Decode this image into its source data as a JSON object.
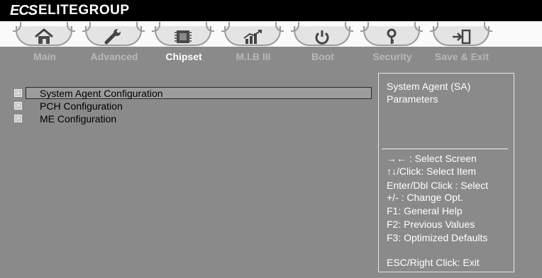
{
  "header": {
    "logo_text": "ECS",
    "brand": "ELITEGROUP"
  },
  "tabs": [
    {
      "label": "Main",
      "icon": "home-icon",
      "active": false
    },
    {
      "label": "Advanced",
      "icon": "wrench-icon",
      "active": false
    },
    {
      "label": "Chipset",
      "icon": "chip-icon",
      "active": true
    },
    {
      "label": "M.I.B III",
      "icon": "performance-chart-icon",
      "active": false
    },
    {
      "label": "Boot",
      "icon": "power-icon",
      "active": false
    },
    {
      "label": "Security",
      "icon": "key-icon",
      "active": false
    },
    {
      "label": "Save & Exit",
      "icon": "exit-door-icon",
      "active": false
    }
  ],
  "menu": {
    "items": [
      {
        "label": "System Agent Configuration",
        "selected": true
      },
      {
        "label": "PCH Configuration",
        "selected": false
      },
      {
        "label": "ME Configuration",
        "selected": false
      }
    ],
    "marker_glyph": ">"
  },
  "help": {
    "description": [
      "System Agent (SA)",
      "Parameters"
    ],
    "keys": [
      "→← : Select Screen",
      "↑↓/Click: Select Item",
      "Enter/Dbl Click : Select",
      "+/- : Change Opt.",
      "F1: General Help",
      "F2: Previous Values",
      "F3: Optimized Defaults",
      "ESC/Right Click: Exit"
    ]
  },
  "colors": {
    "background": "#8a8a8a",
    "tab_strip": "#fafafa",
    "highlight": "#9c9c9c",
    "text_dark": "#000000",
    "text_light": "#ffffff",
    "tab_inactive": "#b8b8b8"
  }
}
